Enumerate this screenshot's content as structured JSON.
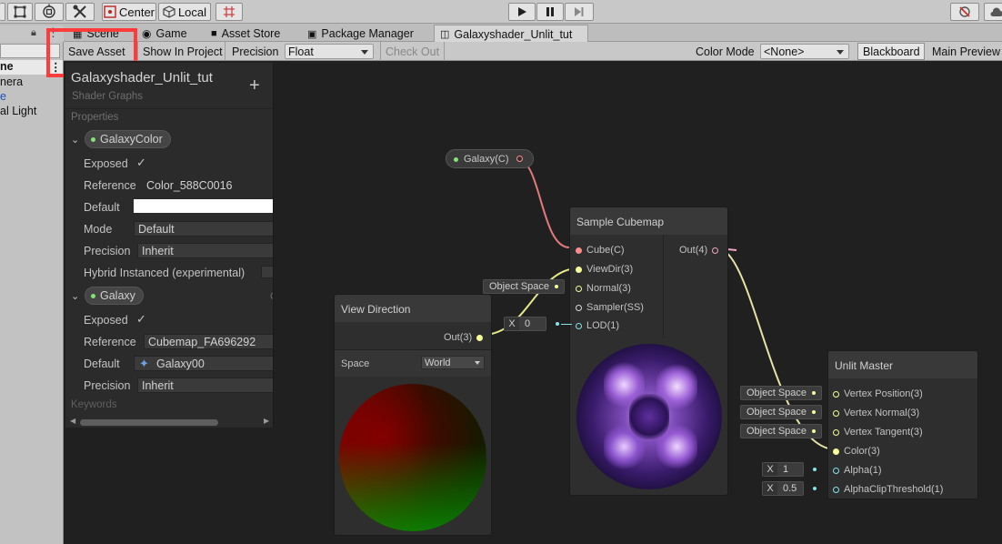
{
  "toolbar": {
    "center_label": "Center",
    "local_label": "Local",
    "icons": [
      "rect-tool-icon",
      "transform-tool-icon",
      "custom-tool-icon",
      "grid-snap-icon",
      "play-icon",
      "pause-icon",
      "step-icon",
      "collab-icon",
      "cloud-icon"
    ]
  },
  "tabs": [
    {
      "label": "Scene",
      "icon": "scene-icon"
    },
    {
      "label": "Game",
      "icon": "game-icon"
    },
    {
      "label": "Asset Store",
      "icon": "asset-store-icon"
    },
    {
      "label": "Package Manager",
      "icon": "package-icon"
    },
    {
      "label": "Galaxyshader_Unlit_tut",
      "icon": "shader-graph-icon"
    }
  ],
  "hierarchy": {
    "items": [
      "ne",
      "nera",
      "e",
      "al Light"
    ]
  },
  "sg_toolbar": {
    "save_asset": "Save Asset",
    "show_in_project": "Show In Project",
    "precision_label": "Precision",
    "precision_value": "Float",
    "check_out": "Check Out",
    "color_mode_label": "Color Mode",
    "color_mode_value": "<None>",
    "blackboard": "Blackboard",
    "main_preview": "Main Preview"
  },
  "blackboard": {
    "title": "Galaxyshader_Unlit_tut",
    "subtitle": "Shader Graphs",
    "add_symbol": "+",
    "properties_header": "Properties",
    "keywords_header": "Keywords",
    "props": [
      {
        "name": "GalaxyColor",
        "exposed_label": "Exposed",
        "reference_label": "Reference",
        "reference_value": "Color_588C0016",
        "default_label": "Default",
        "mode_label": "Mode",
        "mode_value": "Default",
        "precision_label": "Precision",
        "precision_value": "Inherit",
        "hybrid_label": "Hybrid Instanced (experimental)"
      },
      {
        "name": "Galaxy",
        "exposed_label": "Exposed",
        "reference_label": "Reference",
        "reference_value": "Cubemap_FA696292",
        "default_label": "Default",
        "default_value": "Galaxy00",
        "precision_label": "Precision",
        "precision_value": "Inherit",
        "side_letter": "C"
      }
    ]
  },
  "nodes": {
    "galaxy_prop": {
      "label": "Galaxy(C)"
    },
    "view_direction": {
      "title": "View Direction",
      "out": "Out(3)",
      "space_label": "Space",
      "space_value": "World"
    },
    "sample_cubemap": {
      "title": "Sample Cubemap",
      "inputs": [
        "Cube(C)",
        "ViewDir(3)",
        "Normal(3)",
        "Sampler(SS)",
        "LOD(1)"
      ],
      "out": "Out(4)",
      "normal_space": "Object Space",
      "lod_axis": "X",
      "lod_value": "0"
    },
    "unlit_master": {
      "title": "Unlit Master",
      "inputs": [
        "Vertex Position(3)",
        "Vertex Normal(3)",
        "Vertex Tangent(3)",
        "Color(3)",
        "Alpha(1)",
        "AlphaClipThreshold(1)"
      ],
      "space_labels": [
        "Object Space",
        "Object Space",
        "Object Space"
      ],
      "alpha_axis": "X",
      "alpha_value": "1",
      "clip_axis": "X",
      "clip_value": "0.5"
    }
  },
  "colors": {
    "highlight": "#ff3b3b",
    "color_port": "#f08ea0",
    "vector3_port": "#f6ff9a",
    "vector1_port": "#84e4e7",
    "cubemap_port": "#ff8b8b"
  }
}
